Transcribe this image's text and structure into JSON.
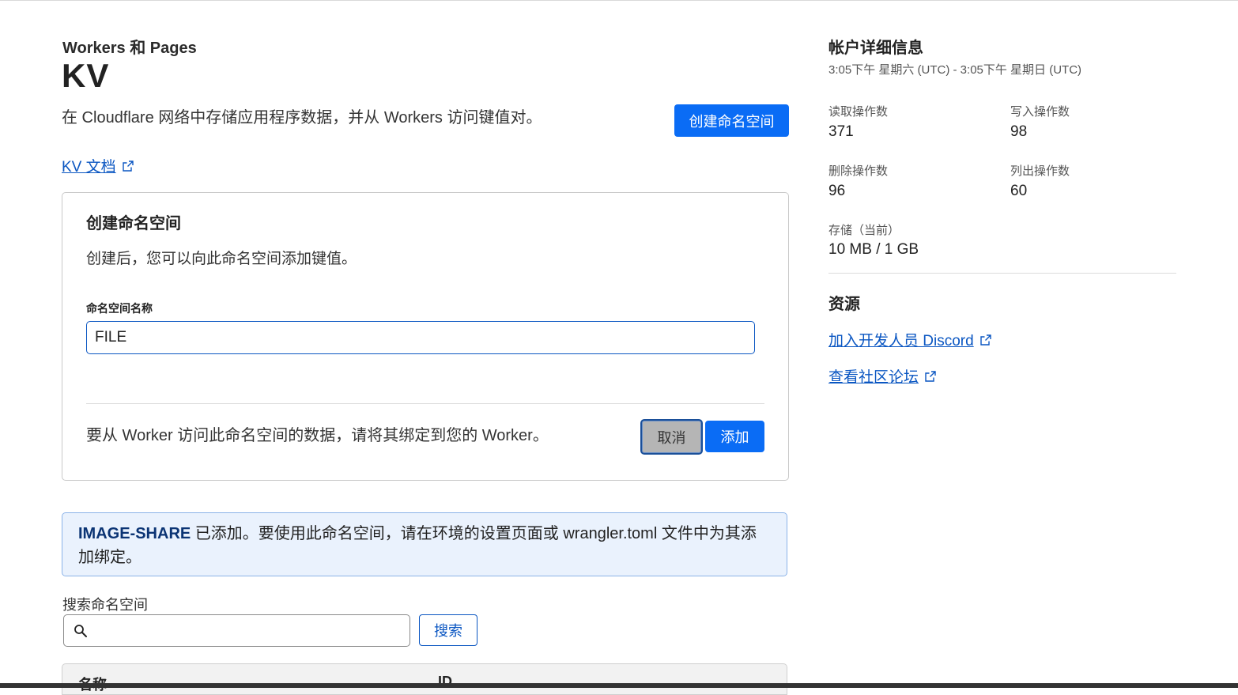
{
  "header": {
    "breadcrumb": "Workers 和 Pages",
    "title": "KV",
    "description": "在 Cloudflare 网络中存储应用程序数据，并从 Workers 访问键值对。",
    "create_button": "创建命名空间",
    "docs_link": "KV 文档"
  },
  "create_card": {
    "title": "创建命名空间",
    "description": "创建后，您可以向此命名空间添加键值。",
    "field_label": "命名空间名称",
    "field_value": "FILE",
    "footer_text": "要从 Worker 访问此命名空间的数据，请将其绑定到您的 Worker。",
    "cancel_button": "取消",
    "add_button": "添加"
  },
  "notice": {
    "name": "IMAGE-SHARE",
    "message": " 已添加。要使用此命名空间，请在环境的设置页面或 wrangler.toml 文件中为其添加绑定。"
  },
  "search": {
    "label": "搜索命名空间",
    "value": "",
    "button": "搜索"
  },
  "table": {
    "columns": [
      "名称",
      "ID"
    ]
  },
  "account": {
    "title": "帐户详细信息",
    "range": "3:05下午 星期六 (UTC) - 3:05下午 星期日 (UTC)",
    "stats": [
      {
        "label": "读取操作数",
        "value": "371"
      },
      {
        "label": "写入操作数",
        "value": "98"
      },
      {
        "label": "删除操作数",
        "value": "96"
      },
      {
        "label": "列出操作数",
        "value": "60"
      },
      {
        "label": "存储（当前）",
        "value": "10 MB / 1 GB"
      }
    ]
  },
  "resources": {
    "title": "资源",
    "links": [
      "加入开发人员 Discord",
      "查看社区论坛"
    ]
  },
  "colors": {
    "primary": "#0a6cf5",
    "link": "#0a56c2",
    "notice_bg": "#eaf2fd"
  }
}
